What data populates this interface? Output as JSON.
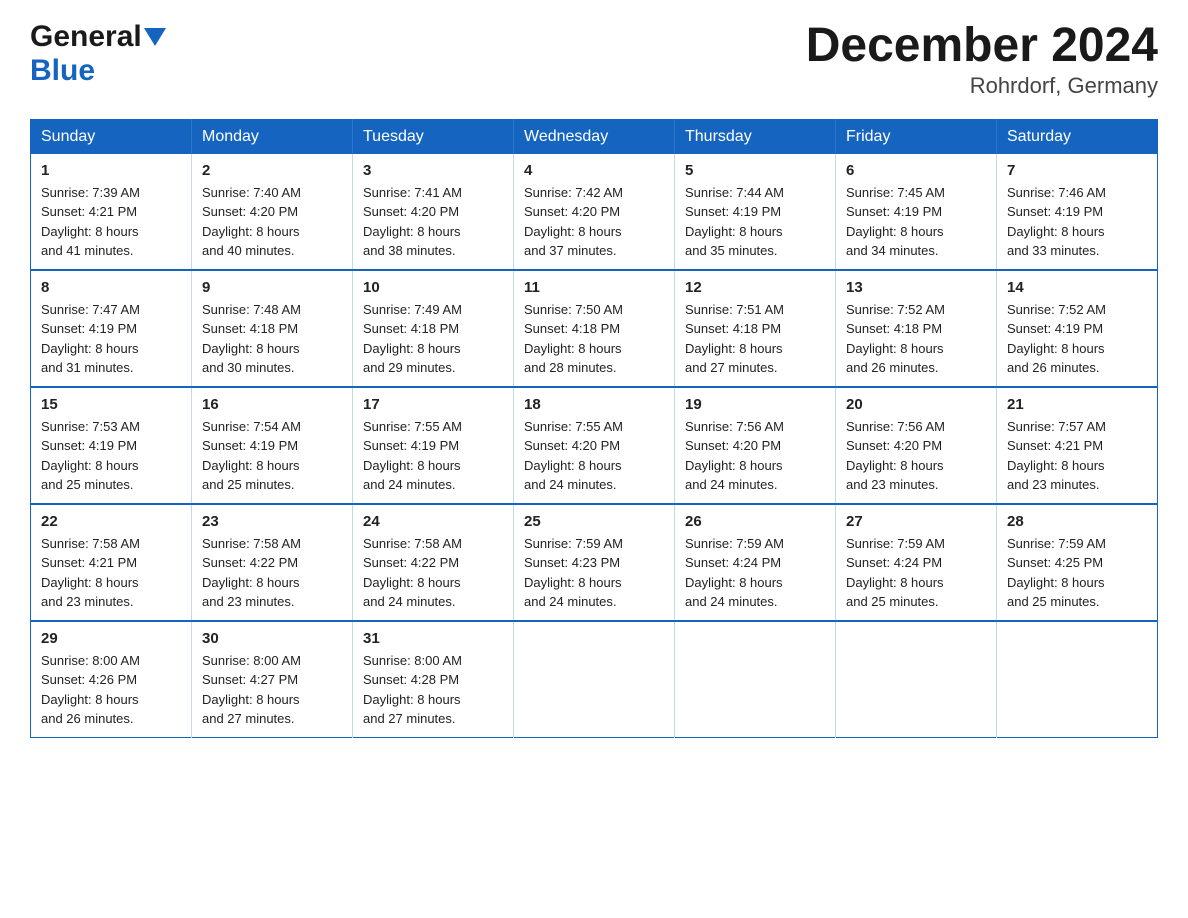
{
  "logo": {
    "general": "General",
    "blue": "Blue"
  },
  "title": {
    "month_year": "December 2024",
    "location": "Rohrdorf, Germany"
  },
  "days_of_week": [
    "Sunday",
    "Monday",
    "Tuesday",
    "Wednesday",
    "Thursday",
    "Friday",
    "Saturday"
  ],
  "weeks": [
    [
      {
        "day": "1",
        "sunrise": "7:39 AM",
        "sunset": "4:21 PM",
        "daylight": "8 hours and 41 minutes."
      },
      {
        "day": "2",
        "sunrise": "7:40 AM",
        "sunset": "4:20 PM",
        "daylight": "8 hours and 40 minutes."
      },
      {
        "day": "3",
        "sunrise": "7:41 AM",
        "sunset": "4:20 PM",
        "daylight": "8 hours and 38 minutes."
      },
      {
        "day": "4",
        "sunrise": "7:42 AM",
        "sunset": "4:20 PM",
        "daylight": "8 hours and 37 minutes."
      },
      {
        "day": "5",
        "sunrise": "7:44 AM",
        "sunset": "4:19 PM",
        "daylight": "8 hours and 35 minutes."
      },
      {
        "day": "6",
        "sunrise": "7:45 AM",
        "sunset": "4:19 PM",
        "daylight": "8 hours and 34 minutes."
      },
      {
        "day": "7",
        "sunrise": "7:46 AM",
        "sunset": "4:19 PM",
        "daylight": "8 hours and 33 minutes."
      }
    ],
    [
      {
        "day": "8",
        "sunrise": "7:47 AM",
        "sunset": "4:19 PM",
        "daylight": "8 hours and 31 minutes."
      },
      {
        "day": "9",
        "sunrise": "7:48 AM",
        "sunset": "4:18 PM",
        "daylight": "8 hours and 30 minutes."
      },
      {
        "day": "10",
        "sunrise": "7:49 AM",
        "sunset": "4:18 PM",
        "daylight": "8 hours and 29 minutes."
      },
      {
        "day": "11",
        "sunrise": "7:50 AM",
        "sunset": "4:18 PM",
        "daylight": "8 hours and 28 minutes."
      },
      {
        "day": "12",
        "sunrise": "7:51 AM",
        "sunset": "4:18 PM",
        "daylight": "8 hours and 27 minutes."
      },
      {
        "day": "13",
        "sunrise": "7:52 AM",
        "sunset": "4:18 PM",
        "daylight": "8 hours and 26 minutes."
      },
      {
        "day": "14",
        "sunrise": "7:52 AM",
        "sunset": "4:19 PM",
        "daylight": "8 hours and 26 minutes."
      }
    ],
    [
      {
        "day": "15",
        "sunrise": "7:53 AM",
        "sunset": "4:19 PM",
        "daylight": "8 hours and 25 minutes."
      },
      {
        "day": "16",
        "sunrise": "7:54 AM",
        "sunset": "4:19 PM",
        "daylight": "8 hours and 25 minutes."
      },
      {
        "day": "17",
        "sunrise": "7:55 AM",
        "sunset": "4:19 PM",
        "daylight": "8 hours and 24 minutes."
      },
      {
        "day": "18",
        "sunrise": "7:55 AM",
        "sunset": "4:20 PM",
        "daylight": "8 hours and 24 minutes."
      },
      {
        "day": "19",
        "sunrise": "7:56 AM",
        "sunset": "4:20 PM",
        "daylight": "8 hours and 24 minutes."
      },
      {
        "day": "20",
        "sunrise": "7:56 AM",
        "sunset": "4:20 PM",
        "daylight": "8 hours and 23 minutes."
      },
      {
        "day": "21",
        "sunrise": "7:57 AM",
        "sunset": "4:21 PM",
        "daylight": "8 hours and 23 minutes."
      }
    ],
    [
      {
        "day": "22",
        "sunrise": "7:58 AM",
        "sunset": "4:21 PM",
        "daylight": "8 hours and 23 minutes."
      },
      {
        "day": "23",
        "sunrise": "7:58 AM",
        "sunset": "4:22 PM",
        "daylight": "8 hours and 23 minutes."
      },
      {
        "day": "24",
        "sunrise": "7:58 AM",
        "sunset": "4:22 PM",
        "daylight": "8 hours and 24 minutes."
      },
      {
        "day": "25",
        "sunrise": "7:59 AM",
        "sunset": "4:23 PM",
        "daylight": "8 hours and 24 minutes."
      },
      {
        "day": "26",
        "sunrise": "7:59 AM",
        "sunset": "4:24 PM",
        "daylight": "8 hours and 24 minutes."
      },
      {
        "day": "27",
        "sunrise": "7:59 AM",
        "sunset": "4:24 PM",
        "daylight": "8 hours and 25 minutes."
      },
      {
        "day": "28",
        "sunrise": "7:59 AM",
        "sunset": "4:25 PM",
        "daylight": "8 hours and 25 minutes."
      }
    ],
    [
      {
        "day": "29",
        "sunrise": "8:00 AM",
        "sunset": "4:26 PM",
        "daylight": "8 hours and 26 minutes."
      },
      {
        "day": "30",
        "sunrise": "8:00 AM",
        "sunset": "4:27 PM",
        "daylight": "8 hours and 27 minutes."
      },
      {
        "day": "31",
        "sunrise": "8:00 AM",
        "sunset": "4:28 PM",
        "daylight": "8 hours and 27 minutes."
      },
      null,
      null,
      null,
      null
    ]
  ],
  "labels": {
    "sunrise": "Sunrise:",
    "sunset": "Sunset:",
    "daylight": "Daylight:"
  }
}
